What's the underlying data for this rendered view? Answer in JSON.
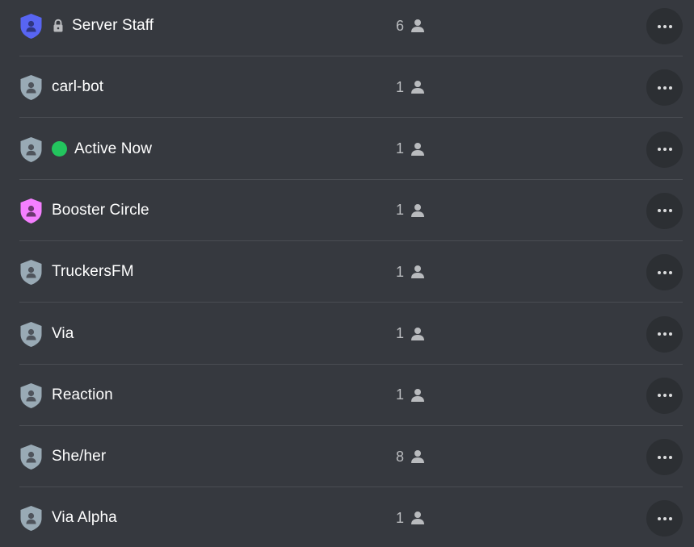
{
  "roles": [
    {
      "name": "Server Staff",
      "count": "6",
      "shield_color": "#5865f2",
      "icon_color": "#2f3680",
      "prefix": "lock"
    },
    {
      "name": "carl-bot",
      "count": "1",
      "shield_color": "#99aab5",
      "icon_color": "#4f545c",
      "prefix": "none"
    },
    {
      "name": "Active Now",
      "count": "1",
      "shield_color": "#99aab5",
      "icon_color": "#4f545c",
      "prefix": "active-dot"
    },
    {
      "name": "Booster Circle",
      "count": "1",
      "shield_color": "#f47fff",
      "icon_color": "#6b3870",
      "prefix": "none"
    },
    {
      "name": "TruckersFM",
      "count": "1",
      "shield_color": "#99aab5",
      "icon_color": "#4f545c",
      "prefix": "none"
    },
    {
      "name": "Via",
      "count": "1",
      "shield_color": "#99aab5",
      "icon_color": "#4f545c",
      "prefix": "none"
    },
    {
      "name": "Reaction",
      "count": "1",
      "shield_color": "#99aab5",
      "icon_color": "#4f545c",
      "prefix": "none"
    },
    {
      "name": "She/her",
      "count": "8",
      "shield_color": "#99aab5",
      "icon_color": "#4f545c",
      "prefix": "none"
    },
    {
      "name": "Via Alpha",
      "count": "1",
      "shield_color": "#99aab5",
      "icon_color": "#4f545c",
      "prefix": "none"
    }
  ],
  "icons": {
    "role": "shield-person-icon",
    "lock": "lock-icon",
    "members": "person-icon",
    "more": "ellipsis-icon"
  },
  "colors": {
    "background": "#36393f",
    "divider": "#4a4d53",
    "text": "#ffffff",
    "count_text": "#b9bbbe",
    "more_button_bg": "#2c2f33",
    "active_dot": "#23c55e"
  }
}
